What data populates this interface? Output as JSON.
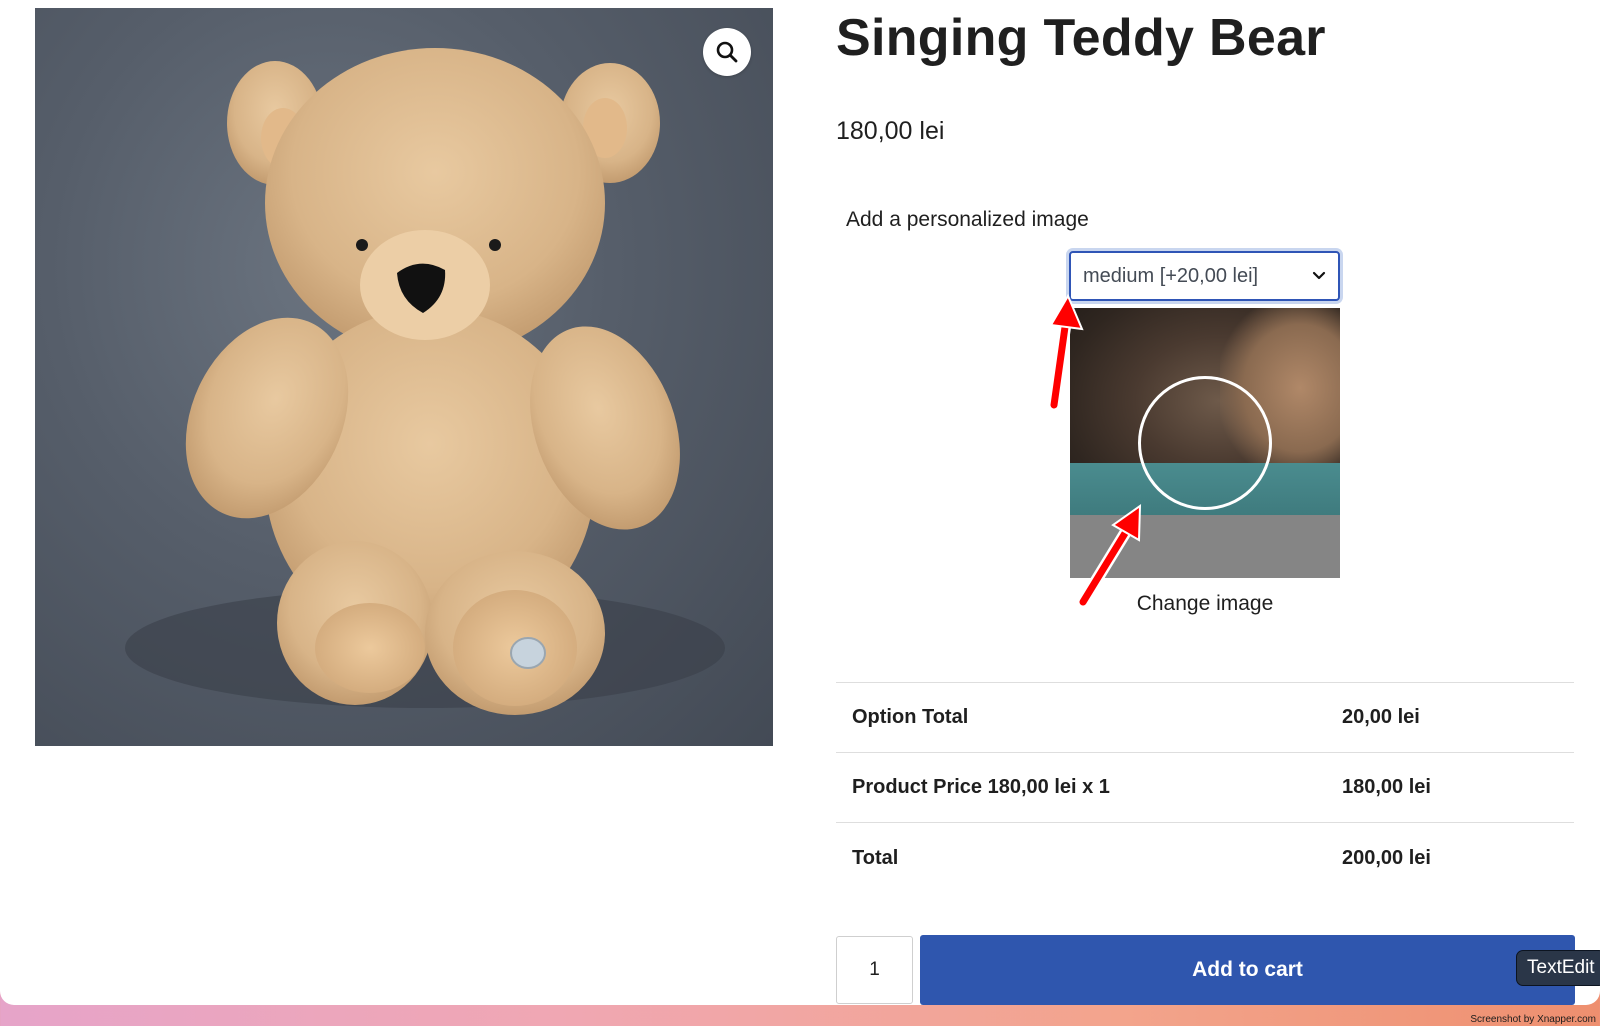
{
  "product": {
    "title": "Singing Teddy Bear",
    "price": "180,00 lei"
  },
  "personalization": {
    "label": "Add a personalized image",
    "selected_size": "medium [+20,00 lei]",
    "change_image_label": "Change image"
  },
  "totals": [
    {
      "label": "Option Total",
      "value": "20,00 lei"
    },
    {
      "label": "Product Price 180,00 lei x 1",
      "value": "180,00 lei"
    },
    {
      "label": "Total",
      "value": "200,00 lei"
    }
  ],
  "cart": {
    "quantity": "1",
    "add_to_cart_label": "Add to cart"
  },
  "overlay": {
    "tooltip": "TextEdit",
    "credit": "Screenshot by Xnapper.com"
  },
  "icons": {
    "zoom": "search-icon",
    "select": "chevron-down-icon"
  },
  "colors": {
    "accent": "#2f56ae",
    "annotation_arrow": "#ff0000"
  }
}
